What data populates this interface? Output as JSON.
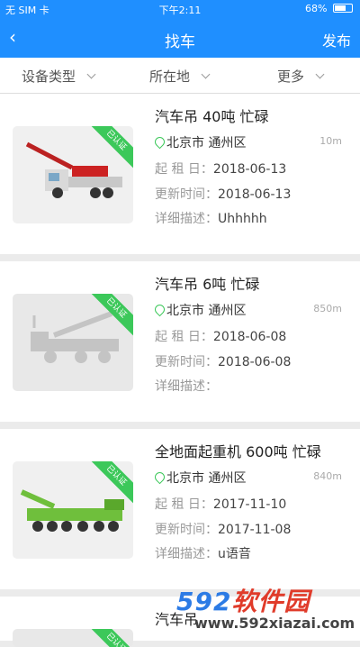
{
  "status": {
    "carrier": "无 SIM 卡",
    "time": "下午2:11",
    "battery": "68%",
    "battery_level": 0.68
  },
  "nav": {
    "back_icon": "chevron-left-icon",
    "title": "找车",
    "publish": "发布"
  },
  "filters": [
    {
      "label": "设备类型"
    },
    {
      "label": "所在地"
    },
    {
      "label": "更多"
    }
  ],
  "listings": [
    {
      "title": "汽车吊 40吨 忙碌",
      "location": "北京市 通州区",
      "distance": "10m",
      "rent_label": "起 租 日：",
      "rent": "2018-06-13",
      "updated_label": "更新时间：",
      "updated": "2018-06-13",
      "desc_label": "详细描述：",
      "desc": "Uhhhhh",
      "badge": "已认证"
    },
    {
      "title": "汽车吊 6吨 忙碌",
      "location": "北京市 通州区",
      "distance": "850m",
      "rent_label": "起 租 日：",
      "rent": "2018-06-08",
      "updated_label": "更新时间：",
      "updated": "2018-06-08",
      "desc_label": "详细描述：",
      "desc": "",
      "badge": "已认证"
    },
    {
      "title": "全地面起重机 600吨 忙碌",
      "location": "北京市 通州区",
      "distance": "840m",
      "rent_label": "起 租 日：",
      "rent": "2017-11-10",
      "updated_label": "更新时间：",
      "updated": "2017-11-08",
      "desc_label": "详细描述：",
      "desc": "u语音",
      "badge": "已认证"
    },
    {
      "title": "汽车吊",
      "badge": "已认证"
    }
  ],
  "watermark": {
    "logo_num": "592",
    "logo_cn": "软件园",
    "url": "www.592xiazai.com"
  }
}
